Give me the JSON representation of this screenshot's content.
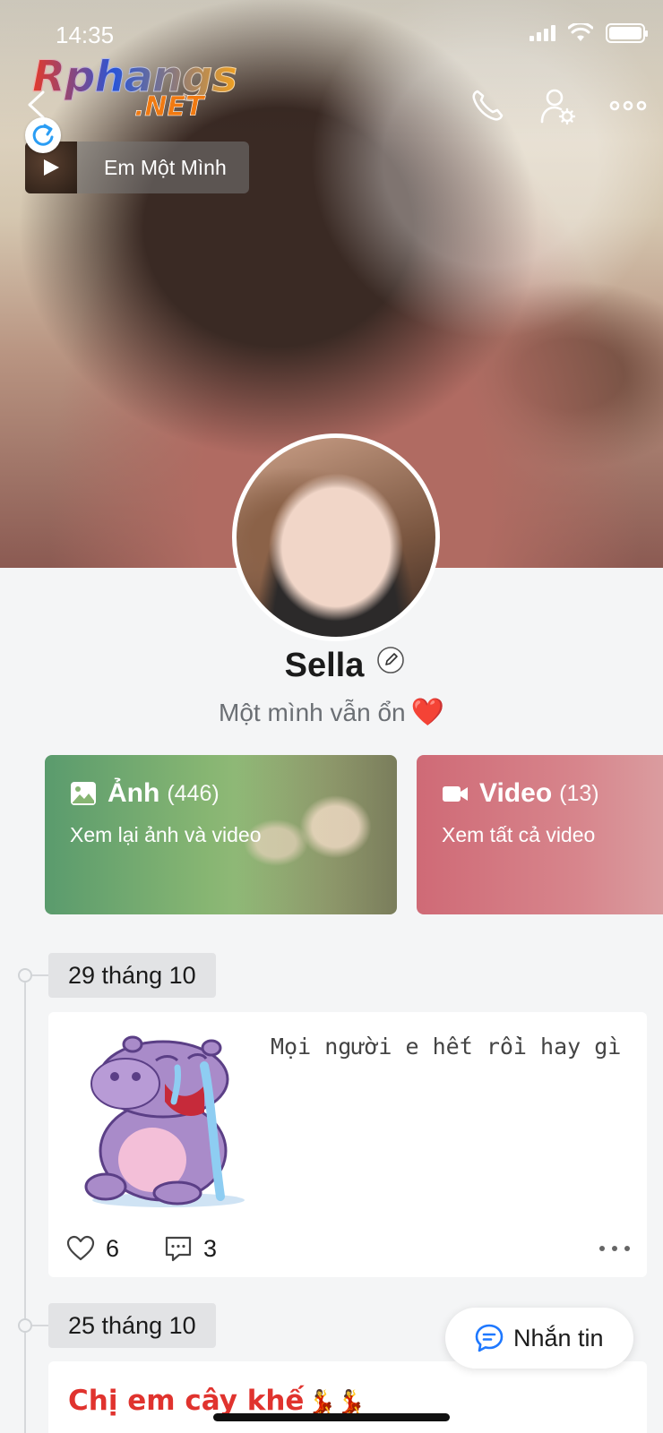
{
  "status_bar": {
    "time": "14:35"
  },
  "watermark": {
    "main": "Rphangs",
    "sub": ".NET"
  },
  "music": {
    "title": "Em Một Mình"
  },
  "profile": {
    "name": "Sella",
    "bio": "Một mình vẫn ổn",
    "bio_emoji": "❤️"
  },
  "cards": {
    "photos": {
      "title": "Ảnh",
      "count": "(446)",
      "subtitle": "Xem lại ảnh và video"
    },
    "videos": {
      "title": "Video",
      "count": "(13)",
      "subtitle": "Xem tất cả video"
    }
  },
  "timeline": [
    {
      "date": "29 tháng 10",
      "text": "Mọi người e hết rồi hay gì",
      "likes": "6",
      "comments": "3"
    },
    {
      "date": "25 tháng 10",
      "title": "Chị em cây khế",
      "title_emoji": "💃💃"
    }
  ],
  "message_button": {
    "label": "Nhắn tin"
  },
  "colors": {
    "photos_card": "#86b572",
    "videos_card": "#d7858c",
    "post_title": "#e0332e",
    "message_icon": "#1e78ff"
  },
  "icons": [
    "back-icon",
    "call-icon",
    "profile-settings-icon",
    "more-icon",
    "play-icon",
    "refresh-icon",
    "edit-icon",
    "image-icon",
    "video-camera-icon",
    "heart-icon",
    "comment-icon",
    "chat-bubble-icon"
  ]
}
